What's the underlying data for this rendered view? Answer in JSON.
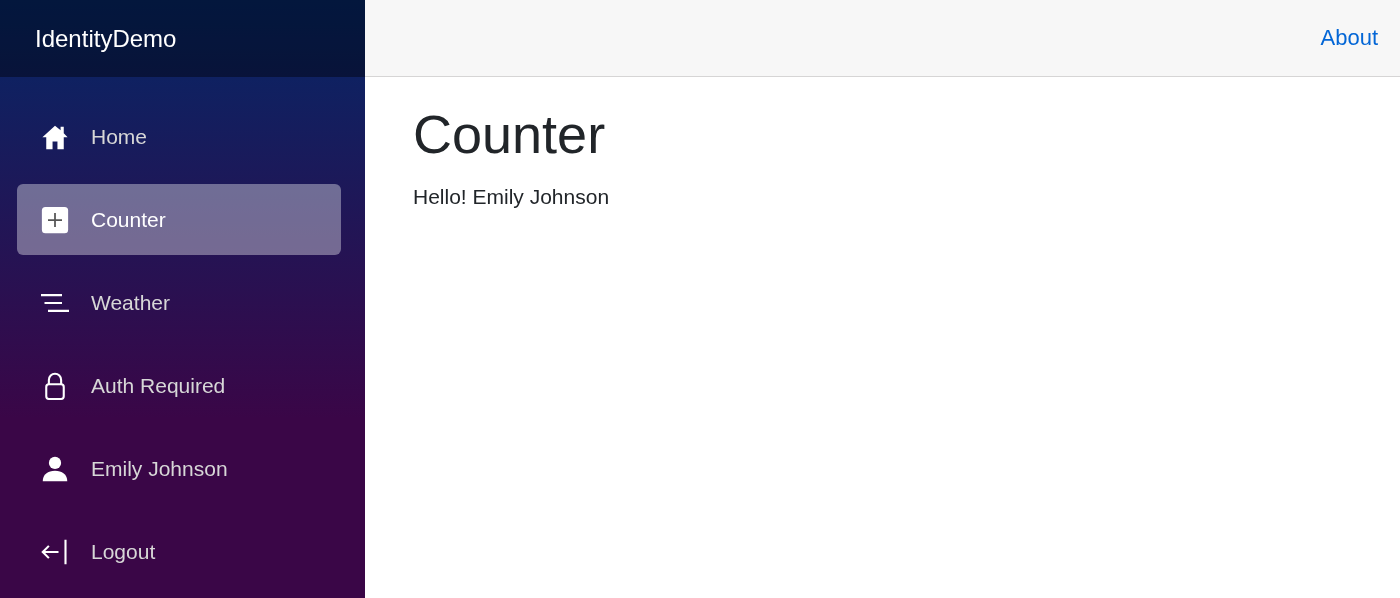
{
  "brand": "IdentityDemo",
  "nav": [
    {
      "kind": "home",
      "label": "Home",
      "selected": false
    },
    {
      "kind": "plus",
      "label": "Counter",
      "selected": true
    },
    {
      "kind": "list",
      "label": "Weather",
      "selected": false
    },
    {
      "kind": "lock",
      "label": "Auth Required",
      "selected": false
    },
    {
      "kind": "person",
      "label": "Emily Johnson",
      "selected": false
    },
    {
      "kind": "logout",
      "label": "Logout",
      "selected": false
    }
  ],
  "top_link": "About",
  "heading": "Counter",
  "greeting": "Hello! Emily Johnson"
}
